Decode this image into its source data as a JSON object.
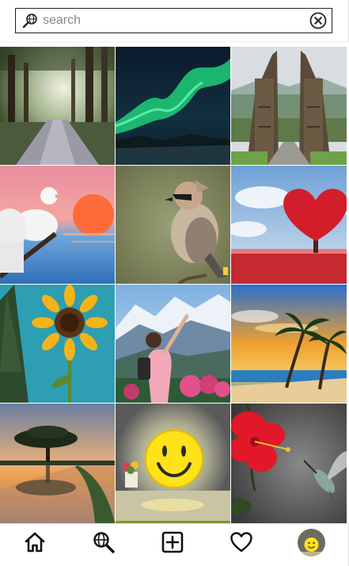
{
  "search": {
    "placeholder": "search",
    "value": ""
  },
  "icons": {
    "search": "globe-search-icon",
    "clear": "close-circle-icon",
    "home": "home-icon",
    "explore": "explore-search-icon",
    "add": "add-post-icon",
    "likes": "heart-icon",
    "profile": "profile-avatar"
  },
  "grid": {
    "tiles": [
      "forest-road-photo",
      "aurora-photo",
      "temple-gate-photo",
      "white-doves-photo",
      "waxwing-bird-photo",
      "heart-tree-photo",
      "sunflower-photo",
      "hiker-mountains-photo",
      "beach-palms-photo",
      "lone-tree-reflection-photo",
      "smiley-lamp-photo",
      "hibiscus-hummingbird-photo"
    ]
  },
  "colors": {
    "border": "#222222",
    "background": "#ffffff",
    "icon": "#111111"
  }
}
